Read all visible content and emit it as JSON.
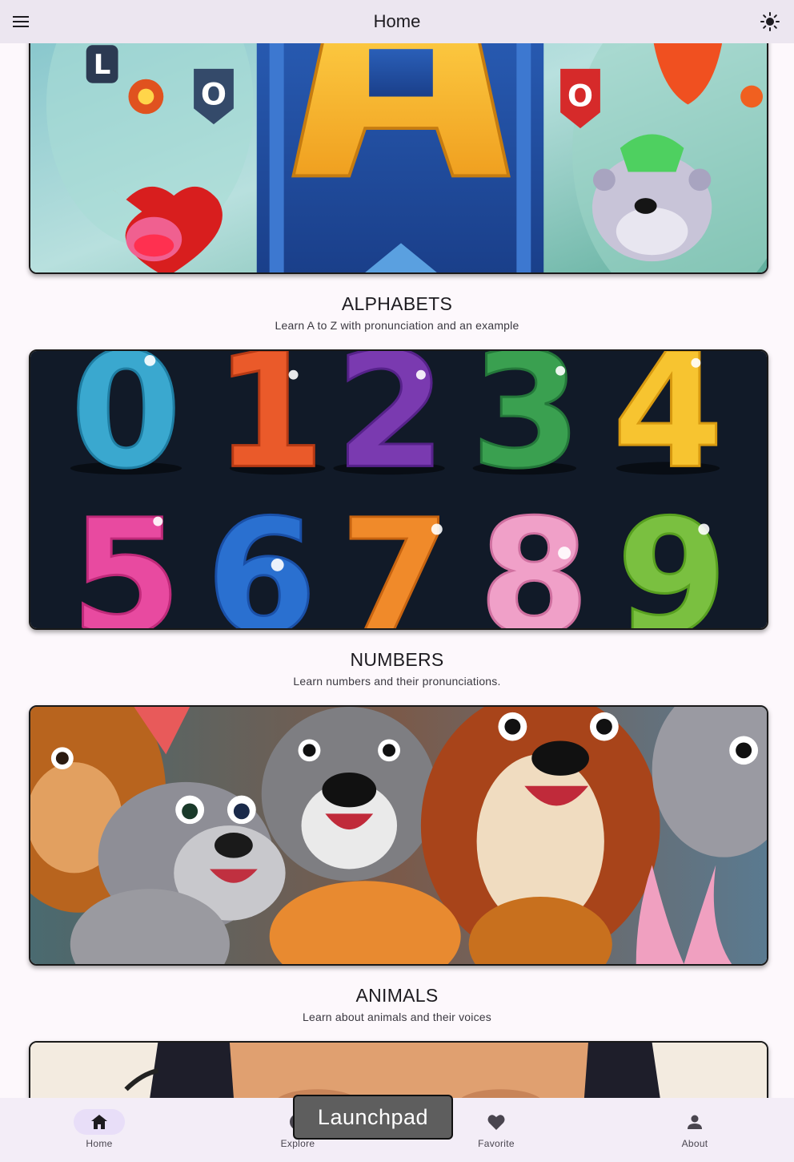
{
  "appbar": {
    "title": "Home",
    "menu_icon": "menu-icon",
    "theme_icon": "sun-icon"
  },
  "cards": [
    {
      "title": "ALPHABETS",
      "subtitle": "Learn A to Z with pronunciation and an example"
    },
    {
      "title": "NUMBERS",
      "subtitle": "Learn numbers and their pronunciations."
    },
    {
      "title": "ANIMALS",
      "subtitle": "Learn about animals and their voices"
    }
  ],
  "numbers_image": {
    "digits": [
      "0",
      "1",
      "2",
      "3",
      "4",
      "5",
      "6",
      "7",
      "8",
      "9"
    ]
  },
  "alphabet_image": {
    "letter": "A",
    "small_letters": [
      "L",
      "O",
      "O"
    ]
  },
  "nav": {
    "items": [
      {
        "label": "Home",
        "icon": "home-icon",
        "active": true
      },
      {
        "label": "Explore",
        "icon": "explore-icon",
        "active": false
      },
      {
        "label": "Favorite",
        "icon": "heart-icon",
        "active": false
      },
      {
        "label": "About",
        "icon": "person-icon",
        "active": false
      }
    ]
  },
  "tooltip": {
    "text": "Launchpad"
  },
  "colors": {
    "appbar_bg": "#ece6f0",
    "nav_bg": "#f3edf7",
    "active_pill": "#e8def8",
    "page_bg": "#fdf8fc"
  }
}
